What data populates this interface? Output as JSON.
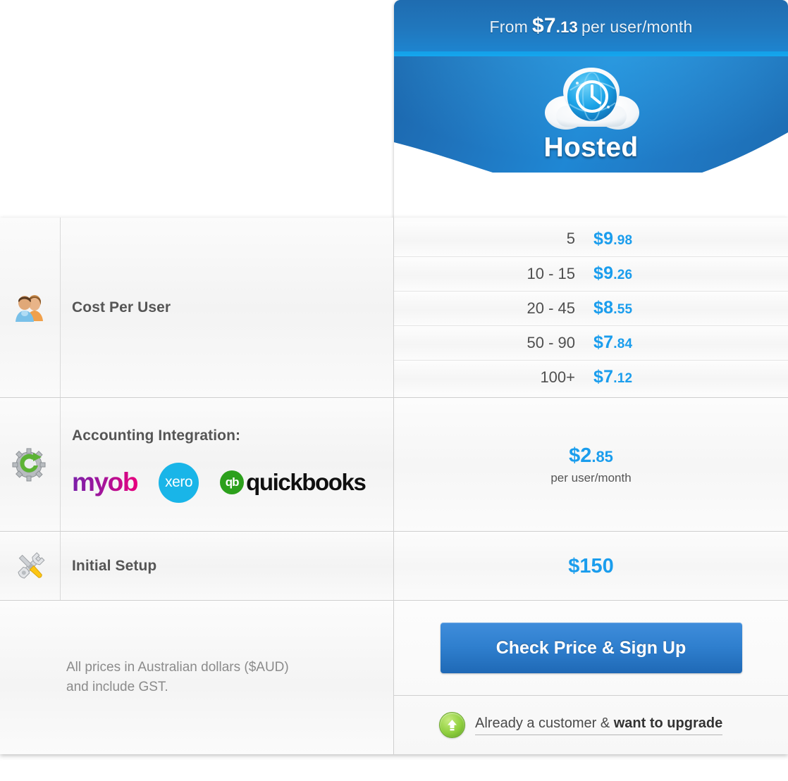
{
  "plan": {
    "banner_prefix": "From",
    "banner_amount_dollars": "$7",
    "banner_amount_cents": ".13",
    "banner_suffix": "per user/month",
    "title": "Hosted",
    "icon": "cloud-clock-icon"
  },
  "rows": {
    "cost": {
      "icon": "users-icon",
      "label": "Cost Per User",
      "tiers": [
        {
          "range": "5",
          "dollars": "$9",
          "cents": ".98"
        },
        {
          "range": "10 - 15",
          "dollars": "$9",
          "cents": ".26"
        },
        {
          "range": "20 - 45",
          "dollars": "$8",
          "cents": ".55"
        },
        {
          "range": "50 - 90",
          "dollars": "$7",
          "cents": ".84"
        },
        {
          "range": "100+",
          "dollars": "$7",
          "cents": ".12"
        }
      ]
    },
    "accounting": {
      "icon": "gear-refresh-icon",
      "label": "Accounting Integration:",
      "logos": [
        {
          "name": "myob-logo",
          "text": "myob"
        },
        {
          "name": "xero-logo",
          "text": "xero"
        },
        {
          "name": "quickbooks-logo",
          "mark": "qb",
          "text": "quickbooks"
        }
      ],
      "price_dollars": "$2",
      "price_cents": ".85",
      "price_sub": "per user/month"
    },
    "setup": {
      "icon": "tools-icon",
      "label": "Initial Setup",
      "price": "$150"
    }
  },
  "footer": {
    "note_line1": "All prices in Australian dollars ($AUD)",
    "note_line2": "and include GST.",
    "cta_label": "Check Price & Sign Up",
    "upgrade_icon": "green-up-arrow-icon",
    "upgrade_text_normal": "Already a customer & ",
    "upgrade_text_bold": "want to upgrade"
  },
  "colors": {
    "accent_blue": "#1a9ded",
    "header_blue": "#1f6cb0",
    "cta_blue": "#2f7fce",
    "myob_purple": "#7b1fa9",
    "myob_pink": "#e8007d",
    "xero_cyan": "#19b5e8",
    "quickbooks_green": "#2ca01c",
    "upgrade_green": "#8fcf3e"
  }
}
